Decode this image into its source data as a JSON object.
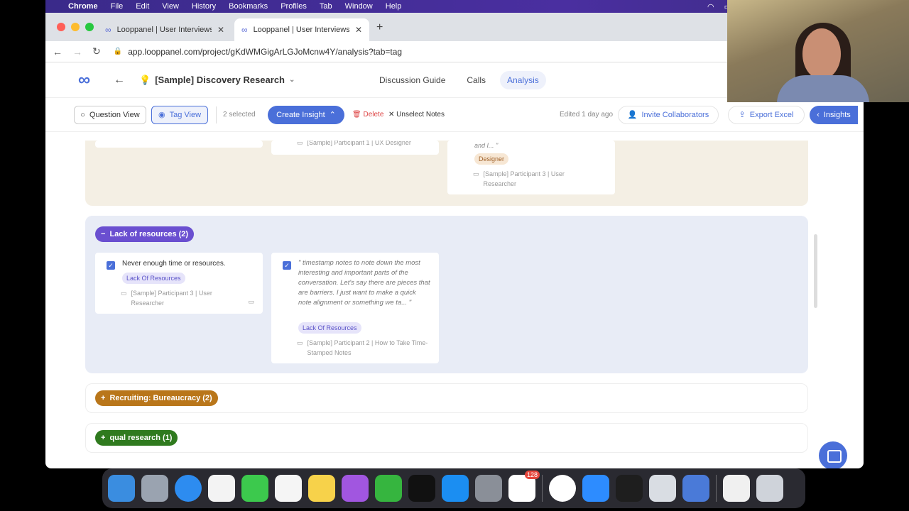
{
  "menubar": {
    "items": [
      "Chrome",
      "File",
      "Edit",
      "View",
      "History",
      "Bookmarks",
      "Profiles",
      "Tab",
      "Window",
      "Help"
    ]
  },
  "browser": {
    "tabs": [
      {
        "title": "Looppanel | User Interviews to"
      },
      {
        "title": "Looppanel | User Interviews to"
      }
    ],
    "url": "app.looppanel.com/project/gKdWMGigArLGJoMcnw4Y/analysis?tab=tag"
  },
  "app": {
    "project_title": "[Sample] Discovery Research",
    "nav": [
      "Discussion Guide",
      "Calls",
      "Analysis"
    ],
    "toolbar": {
      "question_view": "Question View",
      "tag_view": "Tag View",
      "selected": "2 selected",
      "create_insight": "Create Insight",
      "delete": "Delete",
      "unselect": "Unselect Notes",
      "edited": "Edited 1 day ago",
      "invite": "Invite Collaborators",
      "export": "Export Excel",
      "insights": "Insights"
    },
    "top_section": {
      "card2_meta": "[Sample] Participant 1 | UX Designer",
      "card3_quote": "and I... \"",
      "card3_tag": "Designer",
      "card3_meta": "[Sample] Participant 3 | User Researcher"
    },
    "lack_section": {
      "title": "Lack of resources (2)",
      "note1": {
        "text": "Never enough time or resources.",
        "tag": "Lack Of Resources",
        "meta": "[Sample] Participant 3 | User Researcher"
      },
      "note2": {
        "text": "\" timestamp notes to note down the most interesting and important parts of the conversation. Let's say there are pieces that are barriers. I just want to make a quick note alignment or something we ta... \"",
        "tag": "Lack Of Resources",
        "meta": "[Sample] Participant 2 | How to Take Time-Stamped Notes"
      }
    },
    "collapsed_sections": [
      {
        "title": "Recruiting: Bureaucracy (2)",
        "color": "#b9761a"
      },
      {
        "title": "qual research (1)",
        "color": "#2f7a1e"
      }
    ]
  },
  "colors": {
    "accent": "#4a6fd9",
    "lack_pill": "#6a4fd0"
  },
  "dock_badge": "128"
}
